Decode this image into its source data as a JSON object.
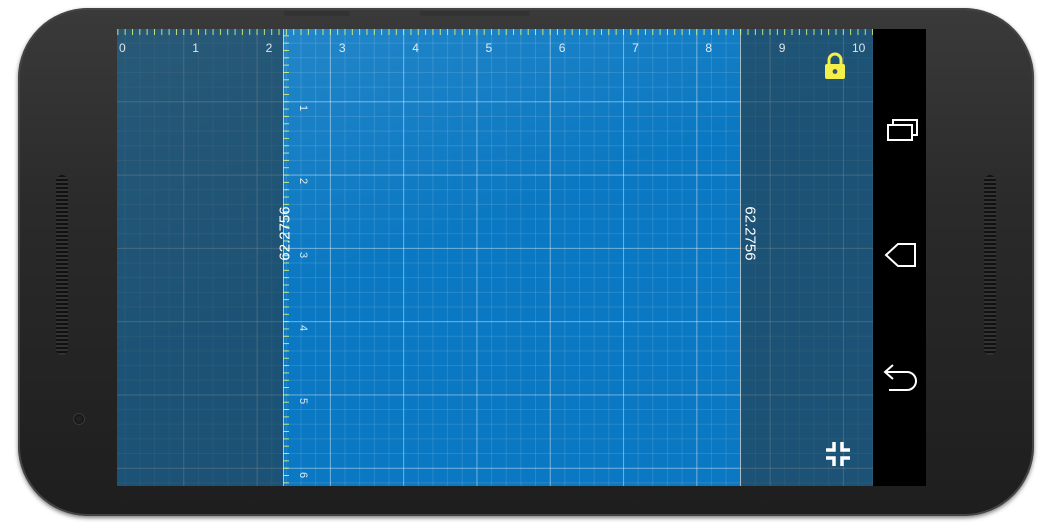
{
  "ruler": {
    "horizontal_ticks": [
      "0",
      "1",
      "2",
      "3",
      "4",
      "5",
      "6",
      "7",
      "8",
      "9",
      "10"
    ],
    "vertical_ticks": [
      "1",
      "2",
      "3",
      "4",
      "5",
      "6"
    ]
  },
  "measurement": {
    "left_value": "62.2756",
    "right_value": "62.2756"
  },
  "colors": {
    "background": "#0a78c2",
    "accent": "#f4f04a",
    "nav_bar": "#000000"
  },
  "icons": {
    "lock": "lock-icon",
    "collapse": "collapse-icon",
    "recents": "recents-icon",
    "home": "home-icon",
    "back": "back-icon"
  }
}
